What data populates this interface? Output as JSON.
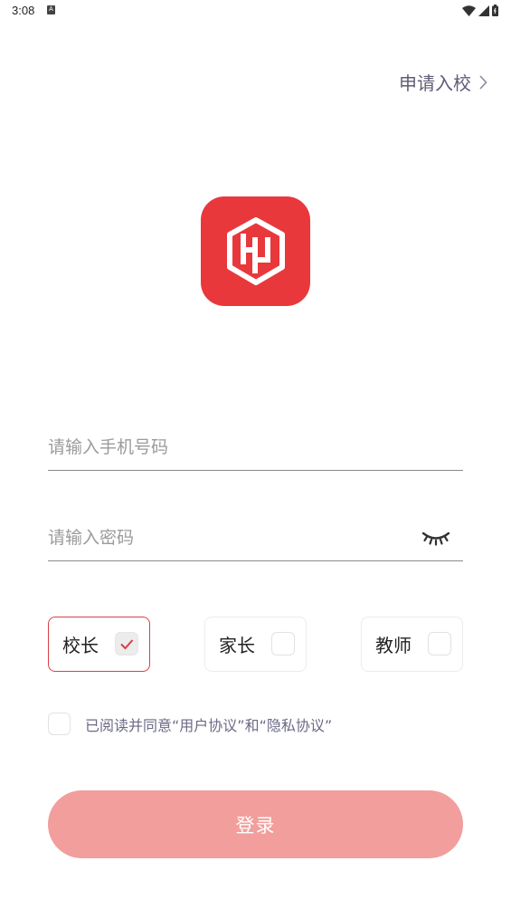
{
  "status_bar": {
    "time": "3:08",
    "notification_glyph": "A",
    "icons": [
      "wifi-icon",
      "signal-icon",
      "battery-icon"
    ]
  },
  "header": {
    "apply_label": "申请入校"
  },
  "logo": {
    "icon": "school-logo-icon",
    "color": "#e8383c"
  },
  "form": {
    "phone_placeholder": "请输入手机号码",
    "phone_value": "",
    "password_placeholder": "请输入密码",
    "password_value": "",
    "password_toggle_icon": "eye-closed-icon"
  },
  "roles": [
    {
      "label": "校长",
      "selected": true
    },
    {
      "label": "家长",
      "selected": false
    },
    {
      "label": "教师",
      "selected": false
    }
  ],
  "agreement": {
    "checked": false,
    "text": "已阅读并同意“用户协议”和“隐私协议”"
  },
  "login": {
    "label": "登录",
    "color": "#f29e9c"
  },
  "colors": {
    "accent": "#e8383c",
    "selected_border": "#d94045",
    "link_text": "#5e5d77"
  }
}
